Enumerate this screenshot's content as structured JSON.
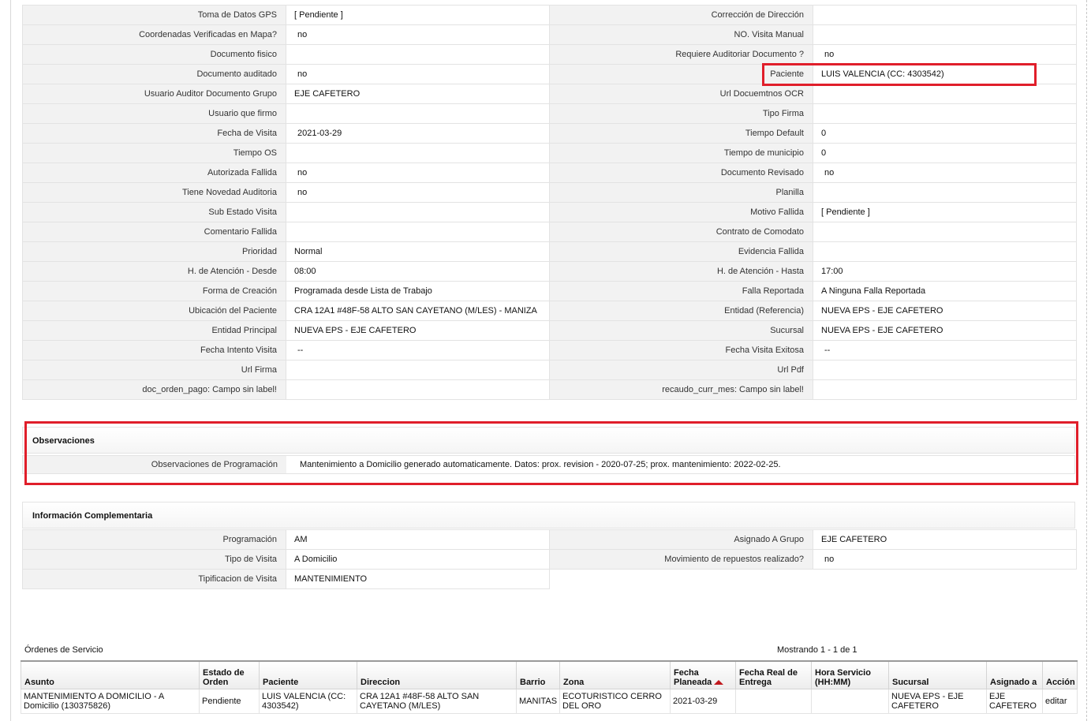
{
  "fields_left": [
    {
      "label": "Toma de Datos GPS",
      "value": "[ Pendiente ]"
    },
    {
      "label": "Coordenadas Verificadas en Mapa?",
      "value": "no"
    },
    {
      "label": "Documento fisico",
      "value": ""
    },
    {
      "label": "Documento auditado",
      "value": "no"
    },
    {
      "label": "Usuario Auditor Documento Grupo",
      "value": "EJE CAFETERO"
    },
    {
      "label": "Usuario que firmo",
      "value": ""
    },
    {
      "label": "Fecha de Visita",
      "value": "2021-03-29"
    },
    {
      "label": "Tiempo OS",
      "value": ""
    },
    {
      "label": "Autorizada Fallida",
      "value": "no"
    },
    {
      "label": "Tiene Novedad Auditoria",
      "value": "no"
    },
    {
      "label": "Sub Estado Visita",
      "value": ""
    },
    {
      "label": "Comentario Fallida",
      "value": ""
    },
    {
      "label": "Prioridad",
      "value": "Normal"
    },
    {
      "label": "H. de Atención - Desde",
      "value": "08:00"
    },
    {
      "label": "Forma de Creación",
      "value": "Programada desde Lista de Trabajo"
    },
    {
      "label": "Ubicación del Paciente",
      "value": "CRA 12A1 #48F-58 ALTO SAN CAYETANO (M/LES) - MANIZA"
    },
    {
      "label": "Entidad Principal",
      "value": "NUEVA EPS - EJE CAFETERO"
    },
    {
      "label": "Fecha Intento Visita",
      "value": "--"
    },
    {
      "label": "Url Firma",
      "value": ""
    },
    {
      "label": "doc_orden_pago: Campo sin label!",
      "value": ""
    }
  ],
  "fields_right": [
    {
      "label": "Corrección de Dirección",
      "value": ""
    },
    {
      "label": "NO. Visita Manual",
      "value": ""
    },
    {
      "label": "Requiere Auditoriar Documento ?",
      "value": "no"
    },
    {
      "label": "Paciente",
      "value": "LUIS VALENCIA (CC: 4303542)"
    },
    {
      "label": "Url Docuemtnos OCR",
      "value": ""
    },
    {
      "label": "Tipo Firma",
      "value": ""
    },
    {
      "label": "Tiempo Default",
      "value": "0"
    },
    {
      "label": "Tiempo de municipio",
      "value": "0"
    },
    {
      "label": "Documento Revisado",
      "value": "no"
    },
    {
      "label": "Planilla",
      "value": ""
    },
    {
      "label": "Motivo Fallida",
      "value": "[ Pendiente ]"
    },
    {
      "label": "Contrato de Comodato",
      "value": ""
    },
    {
      "label": "Evidencia Fallida",
      "value": ""
    },
    {
      "label": "H. de Atención - Hasta",
      "value": "17:00"
    },
    {
      "label": "Falla Reportada",
      "value": "A Ninguna Falla Reportada"
    },
    {
      "label": "Entidad (Referencia)",
      "value": "NUEVA EPS - EJE CAFETERO"
    },
    {
      "label": "Sucursal",
      "value": "NUEVA EPS - EJE CAFETERO"
    },
    {
      "label": "Fecha Visita Exitosa",
      "value": "--"
    },
    {
      "label": "Url Pdf",
      "value": ""
    },
    {
      "label": "recaudo_curr_mes: Campo sin label!",
      "value": ""
    }
  ],
  "observaciones": {
    "title": "Observaciones",
    "label": "Observaciones de Programación",
    "value": "Mantenimiento a Domicilio generado automaticamente. Datos: prox. revision - 2020-07-25; prox. mantenimiento: 2022-02-25."
  },
  "info_complementaria": {
    "title": "Información Complementaria",
    "left": [
      {
        "label": "Programación",
        "value": "AM"
      },
      {
        "label": "Tipo de Visita",
        "value": "A Domicilio"
      },
      {
        "label": "Tipificacion de Visita",
        "value": "MANTENIMIENTO"
      }
    ],
    "right": [
      {
        "label": "Asignado A Grupo",
        "value": "EJE CAFETERO"
      },
      {
        "label": "Movimiento de repuestos realizado?",
        "value": "no"
      }
    ]
  },
  "ordenes": {
    "title": "Órdenes de Servicio",
    "count_text": "Mostrando 1 - 1 de 1",
    "columns": [
      "Asunto",
      "Estado de Orden",
      "Paciente",
      "Direccion",
      "Barrio",
      "Zona",
      "Fecha Planeada",
      "Fecha Real de Entrega",
      "Hora Servicio (HH:MM)",
      "Sucursal",
      "Asignado a",
      "Acción"
    ],
    "rows": [
      [
        "MANTENIMIENTO A DOMICILIO - A Domicilio (130375826)",
        "Pendiente",
        "LUIS VALENCIA (CC: 4303542)",
        "CRA 12A1 #48F-58 ALTO SAN CAYETANO (M/LES)",
        "MANITAS",
        "ECOTURISTICO CERRO DEL ORO",
        "2021-03-29",
        "",
        "",
        "NUEVA EPS - EJE CAFETERO",
        "EJE CAFETERO",
        "editar"
      ]
    ]
  },
  "colors": {
    "highlight": "#e01e2a",
    "label_bg": "#f2f2f2",
    "sort_arrow": "#c0181d"
  }
}
